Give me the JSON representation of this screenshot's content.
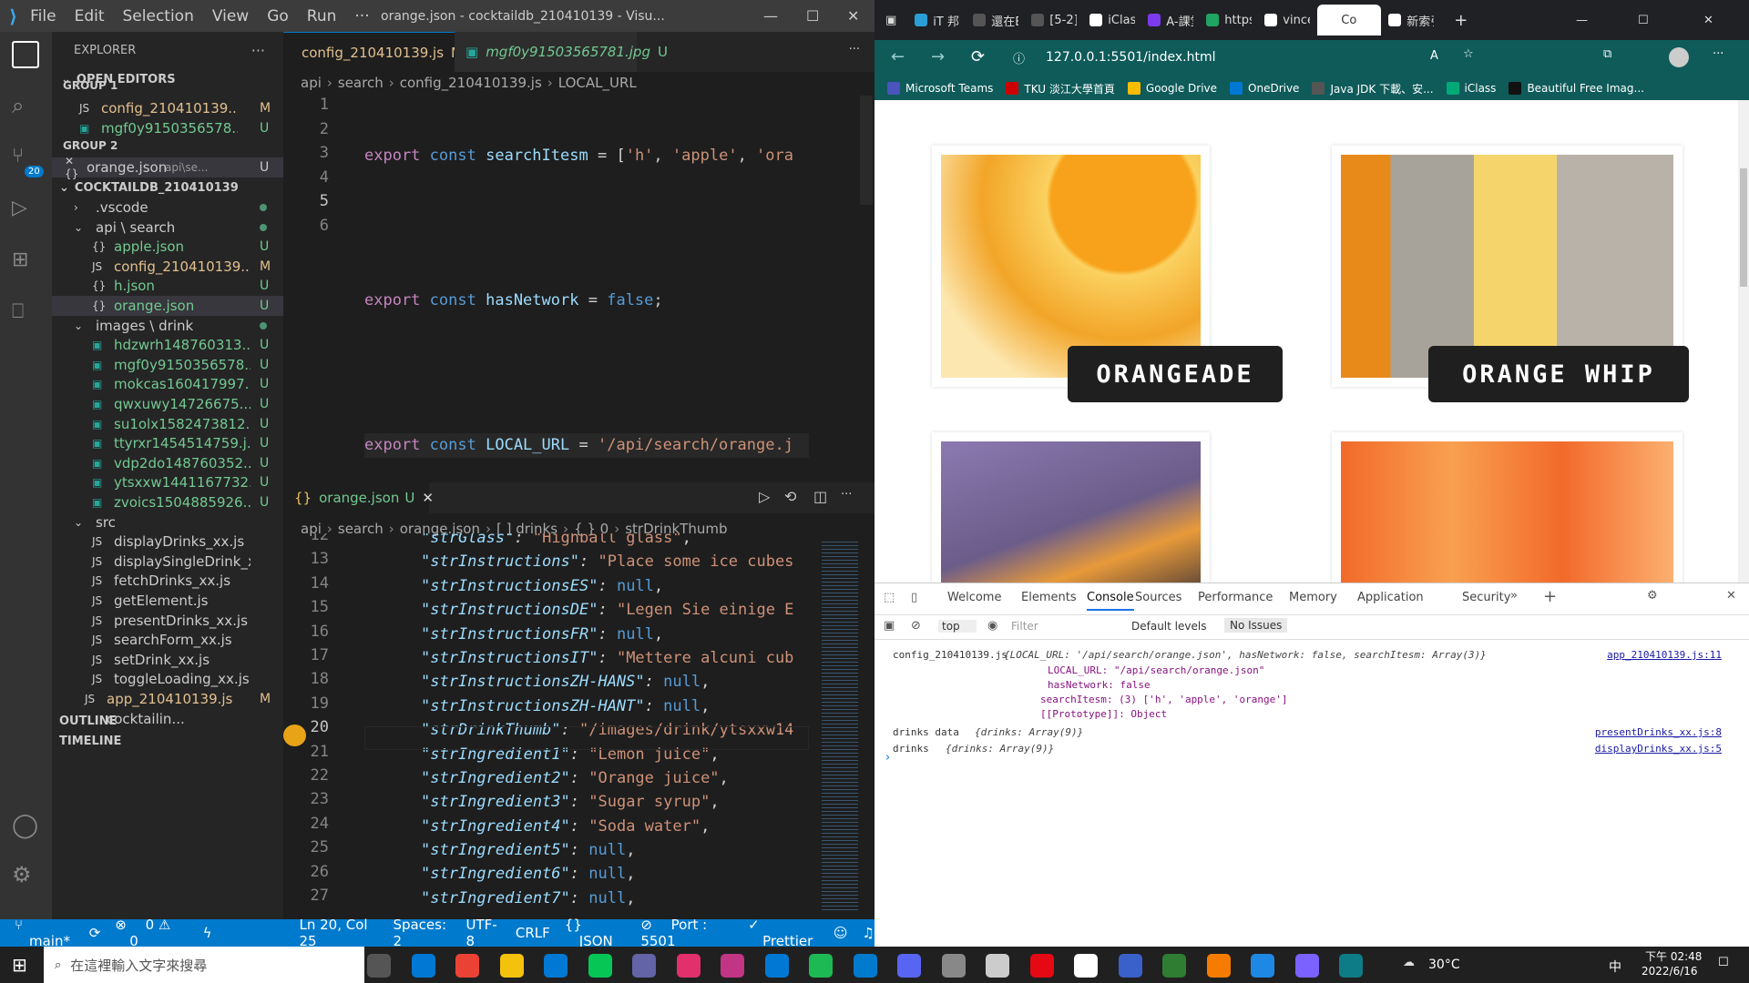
{
  "vscode": {
    "menu": [
      "File",
      "Edit",
      "Selection",
      "View",
      "Go",
      "Run",
      "···"
    ],
    "window_title": "orange.json - cocktaildb_210410139 - Visu...",
    "scm_badge": "20",
    "explorer": {
      "title": "EXPLORER",
      "open_editors": "OPEN EDITORS",
      "group1": "GROUP 1",
      "group2": "GROUP 2",
      "g1": [
        {
          "name": "config_210410139...",
          "badge": "M"
        },
        {
          "name": "mgf0y9150356578...",
          "badge": "U"
        }
      ],
      "g2": [
        {
          "name": "orange.json",
          "desc": "api\\se...",
          "badge": "U"
        }
      ],
      "project": "COCKTAILDB_210410139",
      "tree": [
        {
          "name": ".vscode",
          "badge": ""
        },
        {
          "name": "api \\ search",
          "badge": ""
        },
        {
          "name": "apple.json",
          "badge": "U"
        },
        {
          "name": "config_210410139...",
          "badge": "M"
        },
        {
          "name": "h.json",
          "badge": "U"
        },
        {
          "name": "orange.json",
          "badge": "U"
        },
        {
          "name": "images \\ drink",
          "badge": ""
        },
        {
          "name": "hdzwrh148760313...",
          "badge": "U"
        },
        {
          "name": "mgf0y9150356578...",
          "badge": "U"
        },
        {
          "name": "mokcas160417997...",
          "badge": "U"
        },
        {
          "name": "qwxuwy14726675...",
          "badge": "U"
        },
        {
          "name": "su1olx1582473812...",
          "badge": "U"
        },
        {
          "name": "ttyrxr1454514759.j...",
          "badge": "U"
        },
        {
          "name": "vdp2do148760352...",
          "badge": "U"
        },
        {
          "name": "ytsxxw1441167732...",
          "badge": "U"
        },
        {
          "name": "zvoics1504885926...",
          "badge": "U"
        },
        {
          "name": "src",
          "badge": ""
        },
        {
          "name": "displayDrinks_xx.js",
          "badge": ""
        },
        {
          "name": "displaySingleDrink_xx.js",
          "badge": ""
        },
        {
          "name": "fetchDrinks_xx.js",
          "badge": ""
        },
        {
          "name": "getElement.js",
          "badge": ""
        },
        {
          "name": "presentDrinks_xx.js",
          "badge": ""
        },
        {
          "name": "searchForm_xx.js",
          "badge": ""
        },
        {
          "name": "setDrink_xx.js",
          "badge": ""
        },
        {
          "name": "toggleLoading_xx.js",
          "badge": ""
        },
        {
          "name": "app_210410139.js",
          "badge": "M"
        },
        {
          "name": "cocktailin...",
          "badge": ""
        }
      ],
      "outline": "OUTLINE",
      "timeline": "TIMELINE"
    },
    "editor1": {
      "tabs": [
        {
          "label": "config_210410139.js",
          "flag": "M"
        },
        {
          "label": "mgf0y91503565781.jpg",
          "flag": "U"
        }
      ],
      "crumb": [
        "api",
        "search",
        "config_210410139.js",
        "LOCAL_URL"
      ],
      "lines": [
        "1",
        "2",
        "3",
        "4",
        "5",
        "6"
      ]
    },
    "editor2": {
      "tab": "orange.json",
      "flag": "U",
      "crumb": [
        "api",
        "search",
        "orange.json",
        "[ ] drinks",
        "{ } 0",
        "strDrinkThumb"
      ],
      "lines": [
        "12",
        "13",
        "14",
        "15",
        "16",
        "17",
        "18",
        "19",
        "20",
        "21",
        "22",
        "23",
        "24",
        "25",
        "26",
        "27"
      ],
      "code": [
        [
          "\"strGlass\"",
          ": ",
          "\"Highball glass\"",
          ","
        ],
        [
          "\"strInstructions\"",
          ": ",
          "\"Place some ice cubes",
          ""
        ],
        [
          "\"strInstructionsES\"",
          ": ",
          "null",
          ","
        ],
        [
          "\"strInstructionsDE\"",
          ": ",
          "\"Legen Sie einige E",
          ""
        ],
        [
          "\"strInstructionsFR\"",
          ": ",
          "null",
          ","
        ],
        [
          "\"strInstructionsIT\"",
          ": ",
          "\"Mettere alcuni cub",
          ""
        ],
        [
          "\"strInstructionsZH-HANS\"",
          ": ",
          "null",
          ","
        ],
        [
          "\"strInstructionsZH-HANT\"",
          ": ",
          "null",
          ","
        ],
        [
          "\"strDrinkThumb\"",
          ": ",
          "\"/images/drink/ytsxxw14",
          ""
        ],
        [
          "\"strIngredient1\"",
          ": ",
          "\"Lemon juice\"",
          ","
        ],
        [
          "\"strIngredient2\"",
          ": ",
          "\"Orange juice\"",
          ","
        ],
        [
          "\"strIngredient3\"",
          ": ",
          "\"Sugar syrup\"",
          ","
        ],
        [
          "\"strIngredient4\"",
          ": ",
          "\"Soda water\"",
          ","
        ],
        [
          "\"strIngredient5\"",
          ": ",
          "null",
          ","
        ],
        [
          "\"strIngredient6\"",
          ": ",
          "null",
          ","
        ],
        [
          "\"strIngredient7\"",
          ": ",
          "null",
          ","
        ]
      ]
    },
    "status": {
      "branch": "main*",
      "errors": "0",
      "warnings": "0",
      "pos": "Ln 20, Col 25",
      "spaces": "Spaces: 2",
      "enc": "UTF-8",
      "eol": "CRLF",
      "lang": "JSON",
      "port": "Port : 5501",
      "prettier": "Prettier"
    }
  },
  "browser": {
    "tabs": [
      "iT 邦幫",
      "還在ES",
      "[5-2] C",
      "iClass",
      "A-課堂",
      "https://",
      "vincent",
      "Co",
      "新索引"
    ],
    "url": "127.0.0.1:5501/index.html",
    "bookmarks": [
      "Microsoft Teams",
      "TKU 淡江大學首頁",
      "Google Drive",
      "OneDrive",
      "Java JDK 下載、安...",
      "iClass",
      "Beautiful Free Imag..."
    ],
    "drinks": [
      "ORANGEADE",
      "ORANGE WHIP"
    ],
    "devtools": {
      "tabs": [
        "Welcome",
        "Elements",
        "Console",
        "Sources",
        "Performance",
        "Memory",
        "Application",
        "Security"
      ],
      "context": "top",
      "filter": "Filter",
      "levels": "Default levels",
      "issues": "No Issues",
      "log": [
        {
          "src": "config_210410139.js",
          "text": "{LOCAL_URL: '/api/search/orange.json', hasNetwork: false, searchItesm: Array(3)}",
          "link": "app_210410139.js:11"
        },
        {
          "src": "",
          "text": "LOCAL_URL: \"/api/search/orange.json\"",
          "link": ""
        },
        {
          "src": "",
          "text": "hasNetwork: false",
          "link": ""
        },
        {
          "src": "",
          "text": "searchItesm: (3) ['h', 'apple', 'orange']",
          "link": ""
        },
        {
          "src": "",
          "text": "[[Prototype]]: Object",
          "link": ""
        },
        {
          "src": "drinks data",
          "text": "{drinks: Array(9)}",
          "link": "presentDrinks_xx.js:8"
        },
        {
          "src": "drinks",
          "text": "{drinks: Array(9)}",
          "link": "displayDrinks_xx.js:5"
        }
      ]
    }
  },
  "taskbar": {
    "search": "在這裡輸入文字來搜尋",
    "temp": "30°C",
    "ime": "中",
    "time": "下午 02:48",
    "date": "2022/6/16"
  }
}
